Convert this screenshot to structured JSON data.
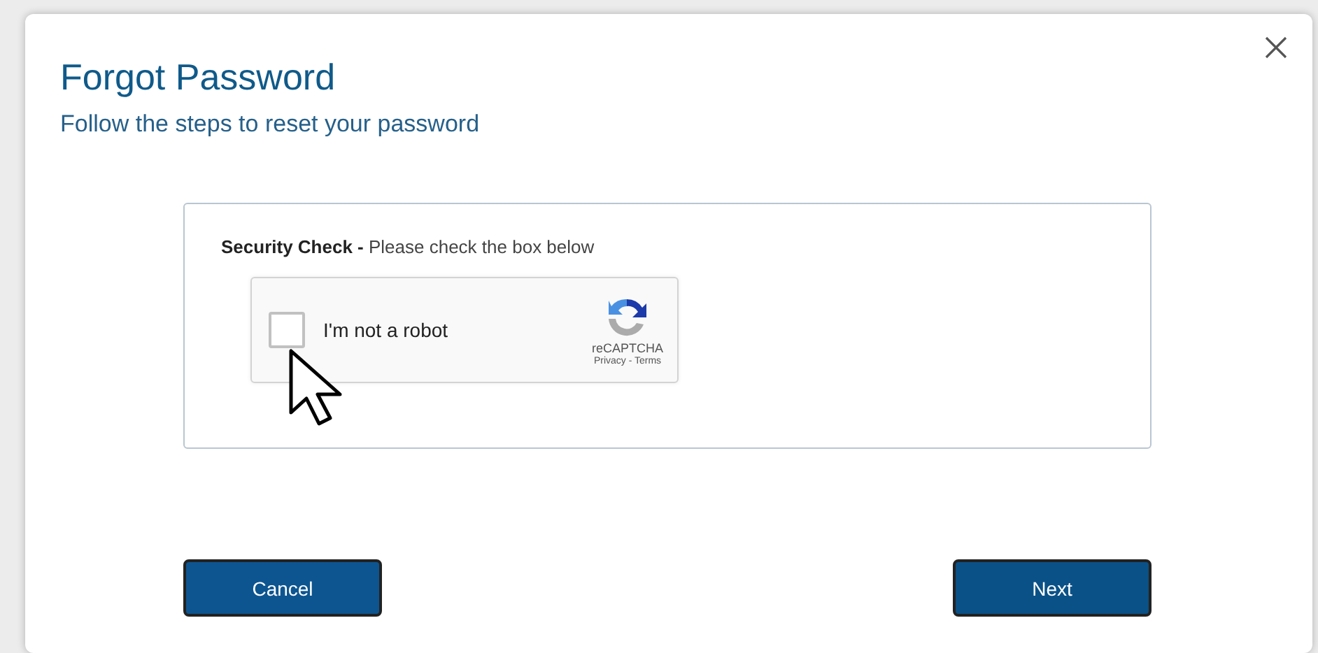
{
  "dialog": {
    "title": "Forgot Password",
    "subtitle": "Follow the steps to reset your password"
  },
  "security_check": {
    "instruction": "**Security Check -** Please check the box below",
    "captcha": {
      "label": "I'm not a robot",
      "checked": false,
      "brand": "reCAPTCHA",
      "links": "Privacy - Terms"
    }
  },
  "buttons": [
    {
      "label": "Cancel",
      "kind": "secondary"
    },
    {
      "label": "Next",
      "kind": "primary"
    }
  ]
}
